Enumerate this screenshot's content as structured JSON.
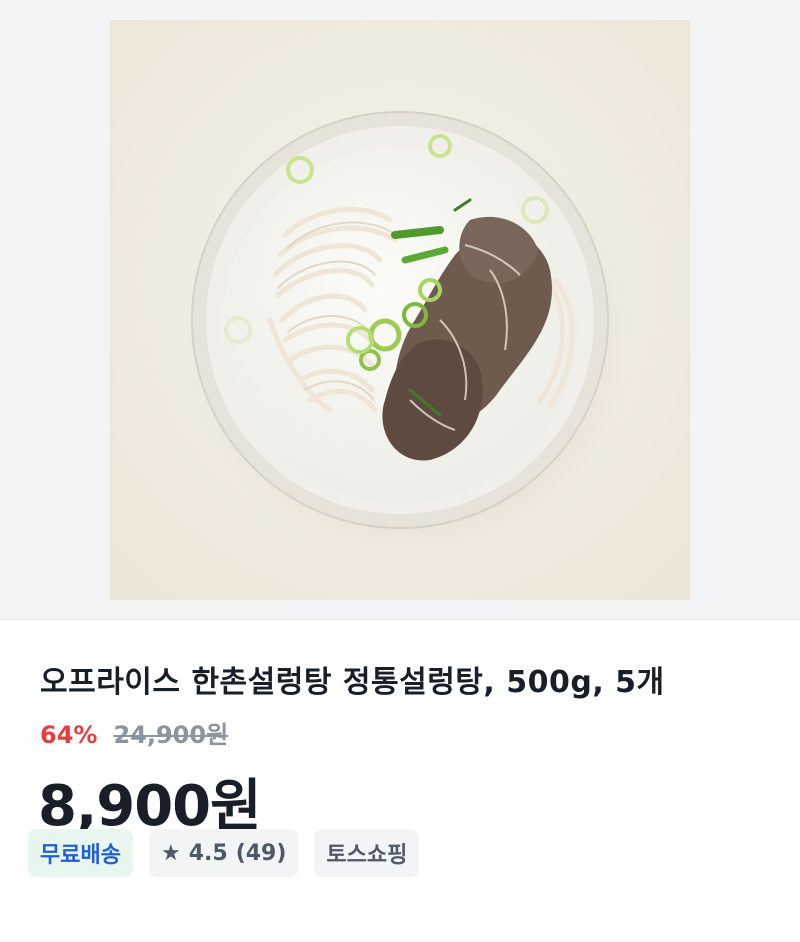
{
  "product": {
    "image_alt": "설렁탕 product photo",
    "title": "오프라이스 한촌설렁탕 정통설렁탕, 500g, 5개",
    "discount": "64%",
    "original_price": "24,900원",
    "sale_price": "8,900원"
  },
  "badges": {
    "delivery": "무료배송",
    "rating_icon": "star-icon",
    "rating_star": "★",
    "rating_value": "4.5",
    "rating_count": "(49)",
    "store": "토스쇼핑"
  },
  "colors": {
    "discount": "#e53e3e",
    "delivery_text": "#1f5fd6",
    "delivery_bg": "#e9f6ef",
    "badge_bg": "#f2f4f6",
    "title": "#191f28"
  }
}
